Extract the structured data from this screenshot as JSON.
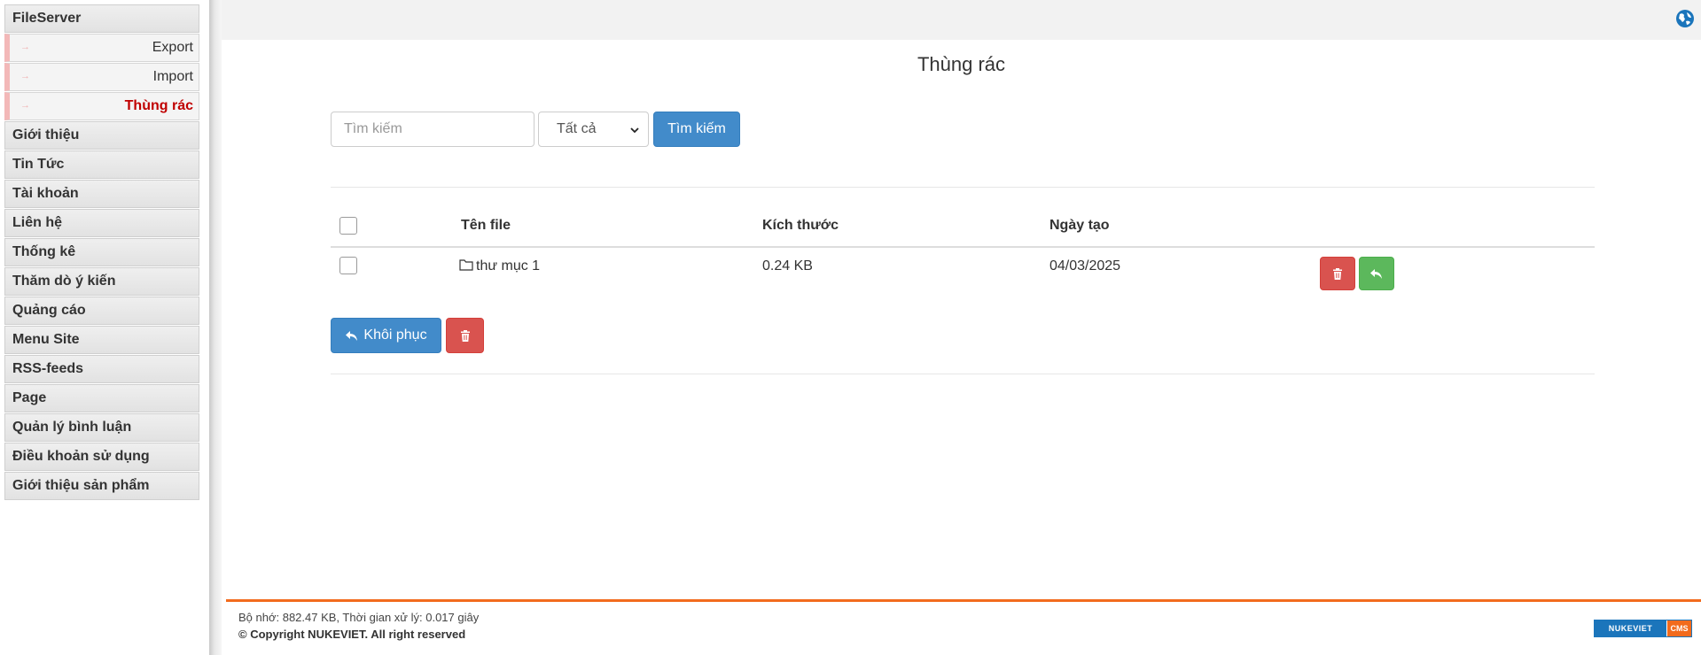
{
  "sidebar": {
    "module": "FileServer",
    "sub_items": [
      {
        "label": "Export",
        "active": false
      },
      {
        "label": "Import",
        "active": false
      },
      {
        "label": "Thùng rác",
        "active": true
      }
    ],
    "items": [
      "Giới thiệu",
      "Tin Tức",
      "Tài khoản",
      "Liên hệ",
      "Thống kê",
      "Thăm dò ý kiến",
      "Quảng cáo",
      "Menu Site",
      "RSS-feeds",
      "Page",
      "Quản lý bình luận",
      "Điều khoản sử dụng",
      "Giới thiệu sản phẩm"
    ]
  },
  "topbar": {
    "icon": "globe-icon"
  },
  "page": {
    "title": "Thùng rác",
    "search": {
      "placeholder": "Tìm kiếm",
      "value": ""
    },
    "filter": {
      "selected": "Tất cả"
    },
    "search_button": "Tìm kiếm"
  },
  "table": {
    "headers": {
      "name": "Tên file",
      "size": "Kích thước",
      "date": "Ngày tạo"
    },
    "rows": [
      {
        "name": "thư mục 1",
        "type": "folder",
        "size": "0.24 KB",
        "date": "04/03/2025"
      }
    ]
  },
  "actions": {
    "restore_label": "Khôi phục"
  },
  "footer": {
    "stats": "Bộ nhớ: 882.47 KB, Thời gian xử lý: 0.017 giây",
    "copyright": "© Copyright NUKEVIET. All right reserved",
    "badge_left": "NUKEVIET",
    "badge_right": "CMS"
  },
  "colors": {
    "primary": "#428bca",
    "danger": "#d9534f",
    "success": "#5cb85c",
    "active_menu": "#c00000",
    "footer_accent": "#f26b1d"
  }
}
